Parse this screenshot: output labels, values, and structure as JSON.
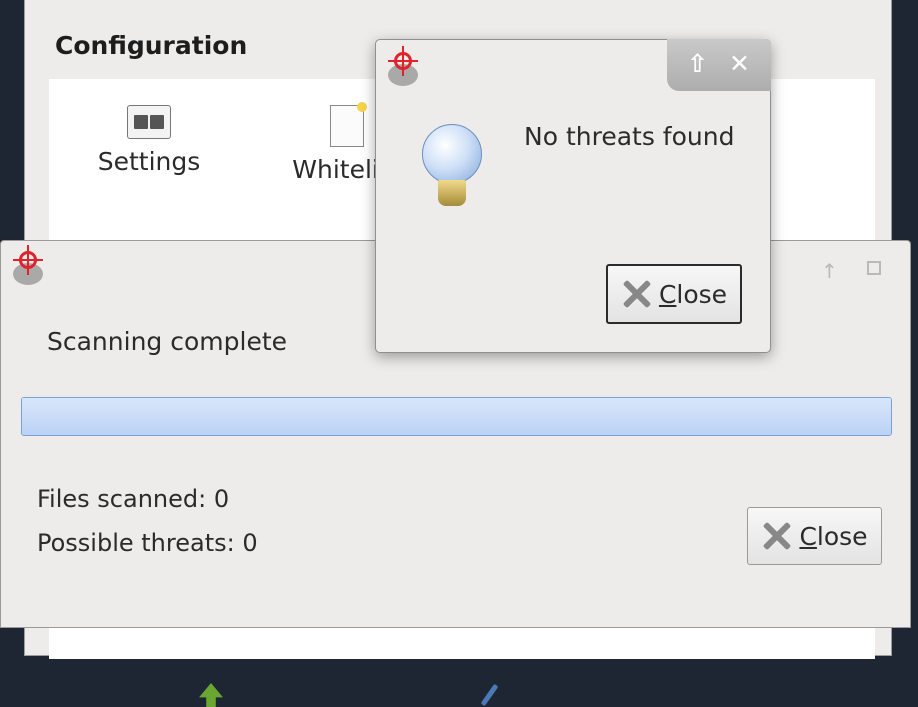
{
  "main_window": {
    "section_title": "Configuration",
    "tools": [
      {
        "label": "Settings",
        "icon": "settings-icon"
      },
      {
        "label": "Whitelist",
        "icon": "whitelist-icon"
      }
    ]
  },
  "scan_dialog": {
    "app_icon": "clamtk-icon",
    "status": "Scanning complete",
    "progress": 1.0,
    "files_scanned": "Files scanned: 0",
    "possible_threats": "Possible threats: 0",
    "close_label": "Close"
  },
  "notification": {
    "app_icon": "clamtk-icon",
    "message": "No threats found",
    "close_label": "Close",
    "controls": {
      "up": "⇧",
      "close": "✕"
    }
  },
  "colors": {
    "progress_fill": "#c6daf8",
    "progress_border": "#7aa0d8",
    "desktop": "#1f2633"
  }
}
